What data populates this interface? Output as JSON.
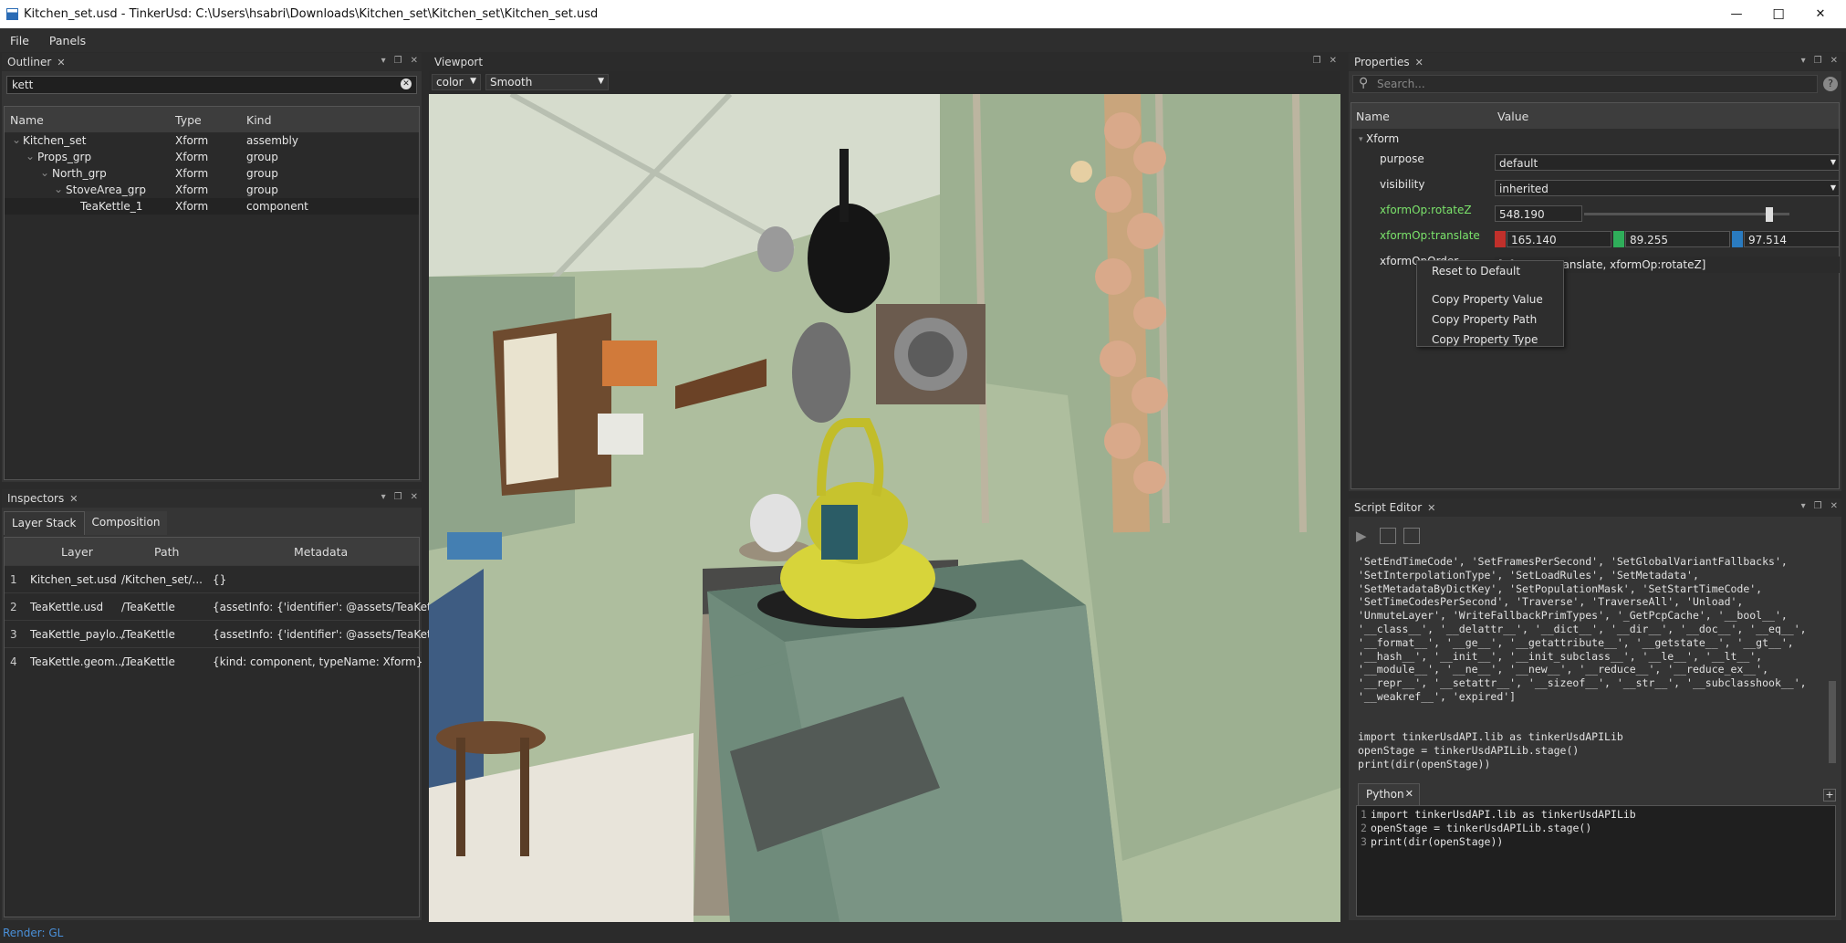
{
  "window": {
    "title": "Kitchen_set.usd - TinkerUsd: C:\\Users\\hsabri\\Downloads\\Kitchen_set\\Kitchen_set\\Kitchen_set.usd",
    "min": "—",
    "max": "☐",
    "close": "✕"
  },
  "menu": [
    "File",
    "Panels"
  ],
  "outliner": {
    "title": "Outliner",
    "search_value": "kett",
    "columns": [
      "Name",
      "Type",
      "Kind"
    ],
    "rows": [
      {
        "name": "Kitchen_set",
        "type": "Xform",
        "kind": "assembly"
      },
      {
        "name": "Props_grp",
        "type": "Xform",
        "kind": "group"
      },
      {
        "name": "North_grp",
        "type": "Xform",
        "kind": "group"
      },
      {
        "name": "StoveArea_grp",
        "type": "Xform",
        "kind": "group"
      },
      {
        "name": "TeaKettle_1",
        "type": "Xform",
        "kind": "component"
      }
    ]
  },
  "inspectors": {
    "title": "Inspectors",
    "tabs": [
      "Layer Stack",
      "Composition"
    ],
    "columns": [
      "Layer",
      "Path",
      "Metadata"
    ],
    "rows": [
      {
        "n": "1",
        "layer": "Kitchen_set.usd",
        "path": "/Kitchen_set/...",
        "meta": "{}"
      },
      {
        "n": "2",
        "layer": "TeaKettle.usd",
        "path": "/TeaKettle",
        "meta": "{assetInfo: {'identifier': @assets/TeaKettle..."
      },
      {
        "n": "3",
        "layer": "TeaKettle_paylo...",
        "path": "/TeaKettle",
        "meta": "{assetInfo: {'identifier': @assets/TeaKettle..."
      },
      {
        "n": "4",
        "layer": "TeaKettle.geom....",
        "path": "/TeaKettle",
        "meta": "{kind: component, typeName: Xform}"
      }
    ]
  },
  "viewport": {
    "title": "Viewport",
    "mode": "color",
    "shading": "Smooth"
  },
  "properties": {
    "title": "Properties",
    "search_placeholder": "Search...",
    "columns": [
      "Name",
      "Value"
    ],
    "group": "Xform",
    "purpose": {
      "label": "purpose",
      "value": "default"
    },
    "visibility": {
      "label": "visibility",
      "value": "inherited"
    },
    "rotateZ": {
      "label": "xformOp:rotateZ",
      "value": "548.190",
      "slider_fraction": 0.9
    },
    "translate": {
      "label": "xformOp:translate",
      "x": "165.140",
      "y": "89.255",
      "z": "97.514"
    },
    "order": {
      "label": "xformOpOrder",
      "value": "[xformOp:translate, xformOp:rotateZ]"
    },
    "context_menu": [
      "Reset to Default",
      "Copy Property Value",
      "Copy Property Path",
      "Copy Property Type"
    ],
    "colors": {
      "x": "#c0302b",
      "y": "#2fae5a",
      "z": "#2a7bc0",
      "accent": "#7be36b"
    }
  },
  "script_editor": {
    "title": "Script Editor",
    "output": [
      "'SetEndTimeCode', 'SetFramesPerSecond', 'SetGlobalVariantFallbacks',",
      "'SetInterpolationType', 'SetLoadRules', 'SetMetadata',",
      "'SetMetadataByDictKey', 'SetPopulationMask', 'SetStartTimeCode',",
      "'SetTimeCodesPerSecond', 'Traverse', 'TraverseAll', 'Unload',",
      "'UnmuteLayer', 'WriteFallbackPrimTypes', '_GetPcpCache', '__bool__',",
      "'__class__', '__delattr__', '__dict__', '__dir__', '__doc__', '__eq__',",
      "'__format__', '__ge__', '__getattribute__', '__getstate__', '__gt__',",
      "'__hash__', '__init__', '__init_subclass__', '__le__', '__lt__',",
      "'__module__', '__ne__', '__new__', '__reduce__', '__reduce_ex__',",
      "'__repr__', '__setattr__', '__sizeof__', '__str__', '__subclasshook__',",
      "'__weakref__', 'expired']",
      "",
      "",
      "import tinkerUsdAPI.lib as tinkerUsdAPILib",
      "openStage = tinkerUsdAPILib.stage()",
      "print(dir(openStage))"
    ],
    "tab": "Python",
    "code": [
      {
        "n": "1",
        "t": "import tinkerUsdAPI.lib as tinkerUsdAPILib"
      },
      {
        "n": "2",
        "t": "openStage = tinkerUsdAPILib.stage()"
      },
      {
        "n": "3",
        "t": "print(dir(openStage))"
      }
    ]
  },
  "status": {
    "text": "Render: GL"
  }
}
